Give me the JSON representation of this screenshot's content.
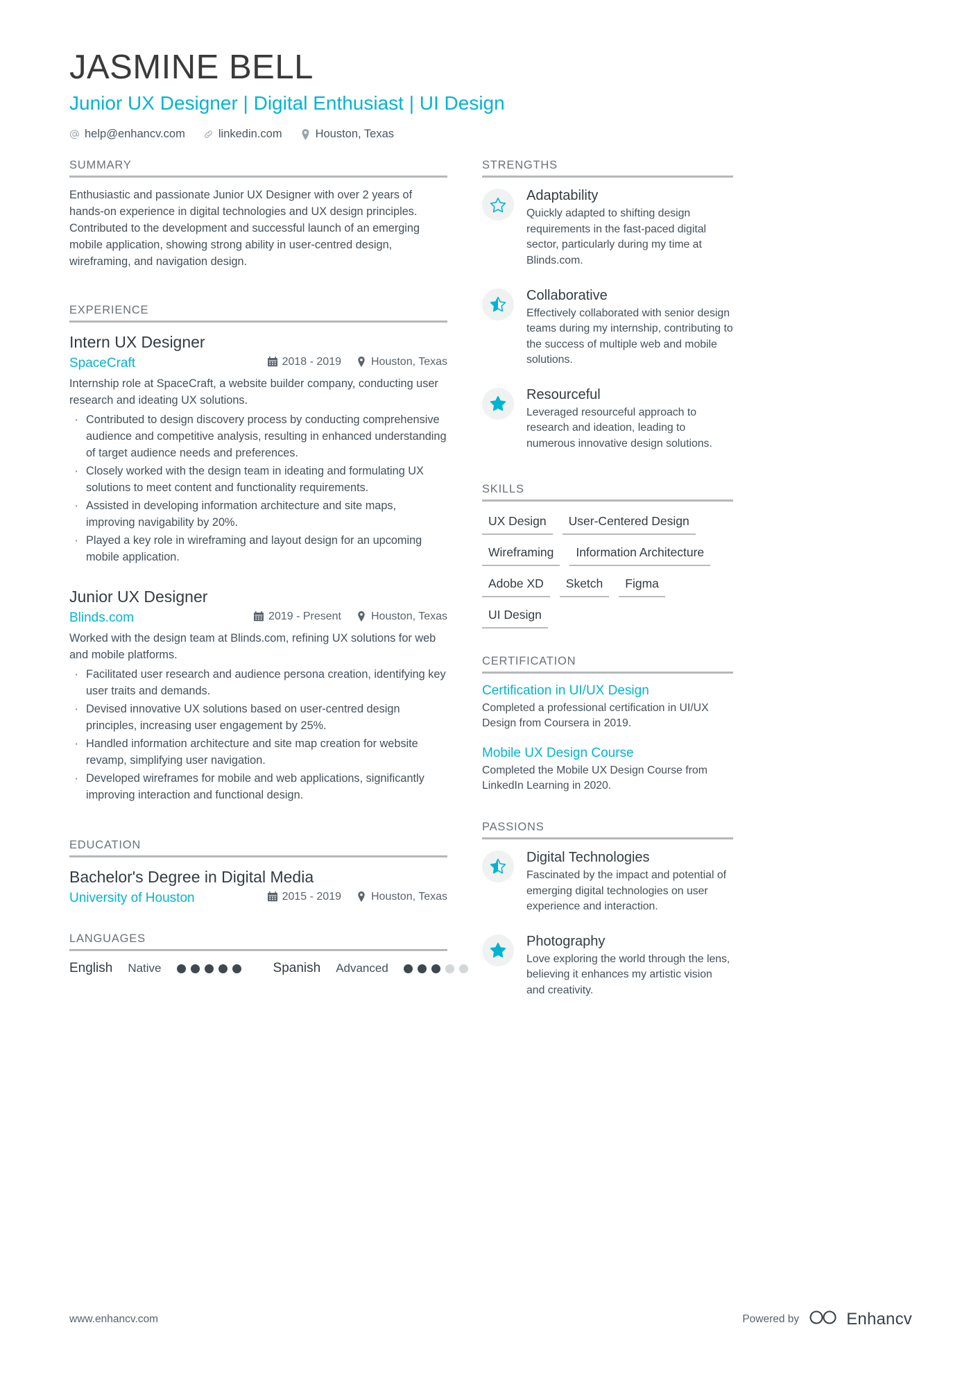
{
  "header": {
    "name": "JASMINE BELL",
    "headline": "Junior UX Designer | Digital Enthusiast | UI Design",
    "contacts": [
      {
        "icon": "at-icon",
        "text": "help@enhancv.com"
      },
      {
        "icon": "link-icon",
        "text": "linkedin.com"
      },
      {
        "icon": "location-pin-icon",
        "text": "Houston, Texas"
      }
    ]
  },
  "summary": {
    "title": "SUMMARY",
    "text": "Enthusiastic and passionate Junior UX Designer with over 2 years of hands-on experience in digital technologies and UX design principles. Contributed to the development and successful launch of an emerging mobile application, showing strong ability in user-centred design, wireframing, and navigation design."
  },
  "experience": {
    "title": "EXPERIENCE",
    "entries": [
      {
        "role": "Intern UX Designer",
        "org": "SpaceCraft",
        "dates": "2018 - 2019",
        "location": "Houston, Texas",
        "description": "Internship role at SpaceCraft, a website builder company, conducting user research and ideating UX solutions.",
        "bullets": [
          "Contributed to design discovery process by conducting comprehensive audience and competitive analysis, resulting in enhanced understanding of target audience needs and preferences.",
          "Closely worked with the design team in ideating and formulating UX solutions to meet content and functionality requirements.",
          "Assisted in developing information architecture and site maps, improving navigability by 20%.",
          "Played a key role in wireframing and layout design for an upcoming mobile application."
        ]
      },
      {
        "role": "Junior UX Designer",
        "org": "Blinds.com",
        "dates": "2019 - Present",
        "location": "Houston, Texas",
        "description": "Worked with the design team at Blinds.com, refining UX solutions for web and mobile platforms.",
        "bullets": [
          "Facilitated user research and audience persona creation, identifying key user traits and demands.",
          "Devised innovative UX solutions based on user-centred design principles, increasing user engagement by 25%.",
          "Handled information architecture and site map creation for website revamp, simplifying user navigation.",
          "Developed wireframes for mobile and web applications, significantly improving interaction and functional design."
        ]
      }
    ]
  },
  "education": {
    "title": "EDUCATION",
    "entries": [
      {
        "degree": "Bachelor's Degree in Digital Media",
        "school": "University of Houston",
        "dates": "2015 - 2019",
        "location": "Houston, Texas"
      }
    ]
  },
  "languages": {
    "title": "LANGUAGES",
    "items": [
      {
        "name": "English",
        "level": "Native",
        "filled": 5,
        "total": 5
      },
      {
        "name": "Spanish",
        "level": "Advanced",
        "filled": 3,
        "total": 5
      }
    ]
  },
  "strengths": {
    "title": "STRENGTHS",
    "items": [
      {
        "icon": "star-outline-icon",
        "fill": "empty",
        "title": "Adaptability",
        "desc": "Quickly adapted to shifting design requirements in the fast-paced digital sector, particularly during my time at Blinds.com."
      },
      {
        "icon": "star-half-icon",
        "fill": "half",
        "title": "Collaborative",
        "desc": "Effectively collaborated with senior design teams during my internship, contributing to the success of multiple web and mobile solutions."
      },
      {
        "icon": "star-filled-icon",
        "fill": "full",
        "title": "Resourceful",
        "desc": "Leveraged resourceful approach to research and ideation, leading to numerous innovative design solutions."
      }
    ]
  },
  "skills": {
    "title": "SKILLS",
    "items": [
      "UX Design",
      "User-Centered Design",
      "Wireframing",
      "Information Architecture",
      "Adobe XD",
      "Sketch",
      "Figma",
      "UI Design"
    ]
  },
  "certification": {
    "title": "CERTIFICATION",
    "items": [
      {
        "name": "Certification in UI/UX Design",
        "desc": "Completed a professional certification in UI/UX Design from Coursera in 2019."
      },
      {
        "name": "Mobile UX Design Course",
        "desc": "Completed the Mobile UX Design Course from LinkedIn Learning in 2020."
      }
    ]
  },
  "passions": {
    "title": "PASSIONS",
    "items": [
      {
        "icon": "star-half-icon",
        "fill": "half",
        "title": "Digital Technologies",
        "desc": "Fascinated by the impact and potential of emerging digital technologies on user experience and interaction."
      },
      {
        "icon": "star-filled-icon",
        "fill": "full",
        "title": "Photography",
        "desc": "Love exploring the world through the lens, believing it enhances my artistic vision and creativity."
      }
    ]
  },
  "footer": {
    "url": "www.enhancv.com",
    "powered_by": "Powered by",
    "brand": "Enhancv"
  },
  "colors": {
    "accent": "#00b5d1",
    "text": "#3d4852",
    "muted": "#6a7179",
    "rule": "#b4b8bb"
  }
}
